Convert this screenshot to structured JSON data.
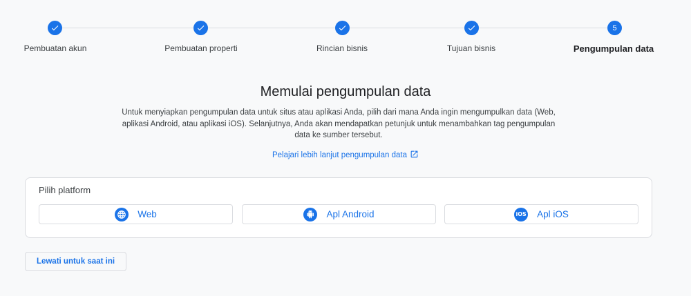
{
  "stepper": {
    "steps": [
      {
        "label": "Pembuatan akun",
        "state": "done"
      },
      {
        "label": "Pembuatan properti",
        "state": "done"
      },
      {
        "label": "Rincian bisnis",
        "state": "done"
      },
      {
        "label": "Tujuan bisnis",
        "state": "done"
      },
      {
        "label": "Pengumpulan data",
        "state": "active",
        "number": "5"
      }
    ],
    "check_icon": "check-icon"
  },
  "main": {
    "title": "Memulai pengumpulan data",
    "description": "Untuk menyiapkan pengumpulan data untuk situs atau aplikasi Anda, pilih dari mana Anda ingin mengumpulkan data (Web, aplikasi Android, atau aplikasi iOS). Selanjutnya, Anda akan mendapatkan petunjuk untuk menambahkan tag pengumpulan data ke sumber tersebut.",
    "learn_more": "Pelajari lebih lanjut pengumpulan data",
    "learn_more_icon": "external-link-icon"
  },
  "platform": {
    "title": "Pilih platform",
    "buttons": [
      {
        "label": "Web",
        "icon": "globe-icon"
      },
      {
        "label": "Apl Android",
        "icon": "android-icon"
      },
      {
        "label": "Apl iOS",
        "icon": "ios-icon",
        "icon_text": "iOS"
      }
    ]
  },
  "skip_button": "Lewati untuk saat ini",
  "colors": {
    "accent": "#1a73e8",
    "background": "#f8f9fa",
    "border": "#dadce0",
    "text": "#3c4043"
  }
}
